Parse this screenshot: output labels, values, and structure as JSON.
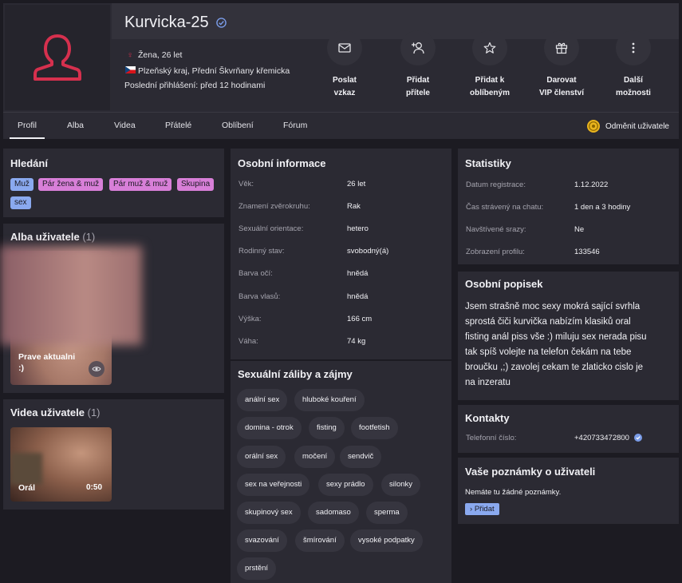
{
  "profile": {
    "name": "Kurvicka-25",
    "gender_age": "Žena, 26 let",
    "location": "Plzeňský kraj, Přední Škvrňany křemicka",
    "last_login": "Poslední přihlášení: před 12 hodinami"
  },
  "actions": [
    {
      "line1": "Poslat",
      "line2": "vzkaz",
      "icon": "envelope-icon"
    },
    {
      "line1": "Přidat",
      "line2": "přítele",
      "icon": "add-friend-icon"
    },
    {
      "line1": "Přidat k",
      "line2": "oblíbeným",
      "icon": "star-icon"
    },
    {
      "line1": "Darovat",
      "line2": "VIP členství",
      "icon": "gift-icon"
    },
    {
      "line1": "Další",
      "line2": "možnosti",
      "icon": "more-icon"
    }
  ],
  "tabs": [
    "Profil",
    "Alba",
    "Videa",
    "Přátelé",
    "Oblíbení",
    "Fórum"
  ],
  "switch_label": "Odměnit uživatele",
  "search": {
    "title": "Hledání",
    "tags": [
      "Muž",
      "Pár žena & muž",
      "Pár muž & muž",
      "Skupina",
      "sex"
    ]
  },
  "albums": {
    "title": "Alba uživatele",
    "count": "(1)",
    "item_label": "Prave aktualni",
    "item_sub": ":)"
  },
  "videos": {
    "title": "Videa uživatele",
    "count": "(1)",
    "item_label": "Orál",
    "duration": "0:50"
  },
  "personal": {
    "title": "Osobní informace",
    "rows": [
      {
        "k": "Věk:",
        "v": "26 let"
      },
      {
        "k": "Znamení zvěrokruhu:",
        "v": "Rak"
      },
      {
        "k": "Sexuální orientace:",
        "v": "hetero"
      },
      {
        "k": "Rodinný stav:",
        "v": "svobodný(á)"
      },
      {
        "k": "Barva očí:",
        "v": "hnědá"
      },
      {
        "k": "Barva vlasů:",
        "v": "hnědá"
      },
      {
        "k": "Výška:",
        "v": "166 cm"
      },
      {
        "k": "Váha:",
        "v": "74 kg"
      }
    ]
  },
  "interests": {
    "title": "Sexuální záliby a zájmy",
    "chips": [
      "anální sex",
      "hluboké kouření",
      "domina - otrok",
      "fisting",
      "footfetish",
      "orální sex",
      "močení",
      "sendvič",
      "sex na veřejnosti",
      "sexy prádlo",
      "silonky",
      "skupinový sex",
      "sadomaso",
      "sperma",
      "svazování",
      "šmírování",
      "vysoké podpatky",
      "prstění"
    ]
  },
  "stats": {
    "title": "Statistiky",
    "rows": [
      {
        "k": "Datum registrace:",
        "v": "1.12.2022"
      },
      {
        "k": "Čas strávený na chatu:",
        "v": "1 den a 3 hodiny"
      },
      {
        "k": "Navštívené srazy:",
        "v": "Ne"
      },
      {
        "k": "Zobrazení profilu:",
        "v": "133546"
      }
    ]
  },
  "bio": {
    "title": "Osobní popisek",
    "lines": [
      "Jsem strašně moc sexy mokrá sající svrhla",
      "sprostá čiči kurvička nabízím klasiků oral",
      "fisting anál piss vše :) miluju sex nerada pisu",
      "tak spíš volejte na telefon čekám na tebe",
      "broučku ,;) zavolej cekam te zlaticko cislo je",
      "na inzeratu"
    ]
  },
  "contacts": {
    "title": "Kontakty",
    "phone_label": "Telefonní číslo:",
    "phone": "+420733472800"
  },
  "notes": {
    "title": "Vaše poznámky o uživateli",
    "empty": "Nemáte tu žádné poznámky.",
    "add_label": "Přidat"
  },
  "colors": {
    "accent_red": "#d6304e",
    "tag_blue": "#8aa9ef",
    "tag_pink": "#d87fd8",
    "verified_blue": "#7a9ce8"
  }
}
